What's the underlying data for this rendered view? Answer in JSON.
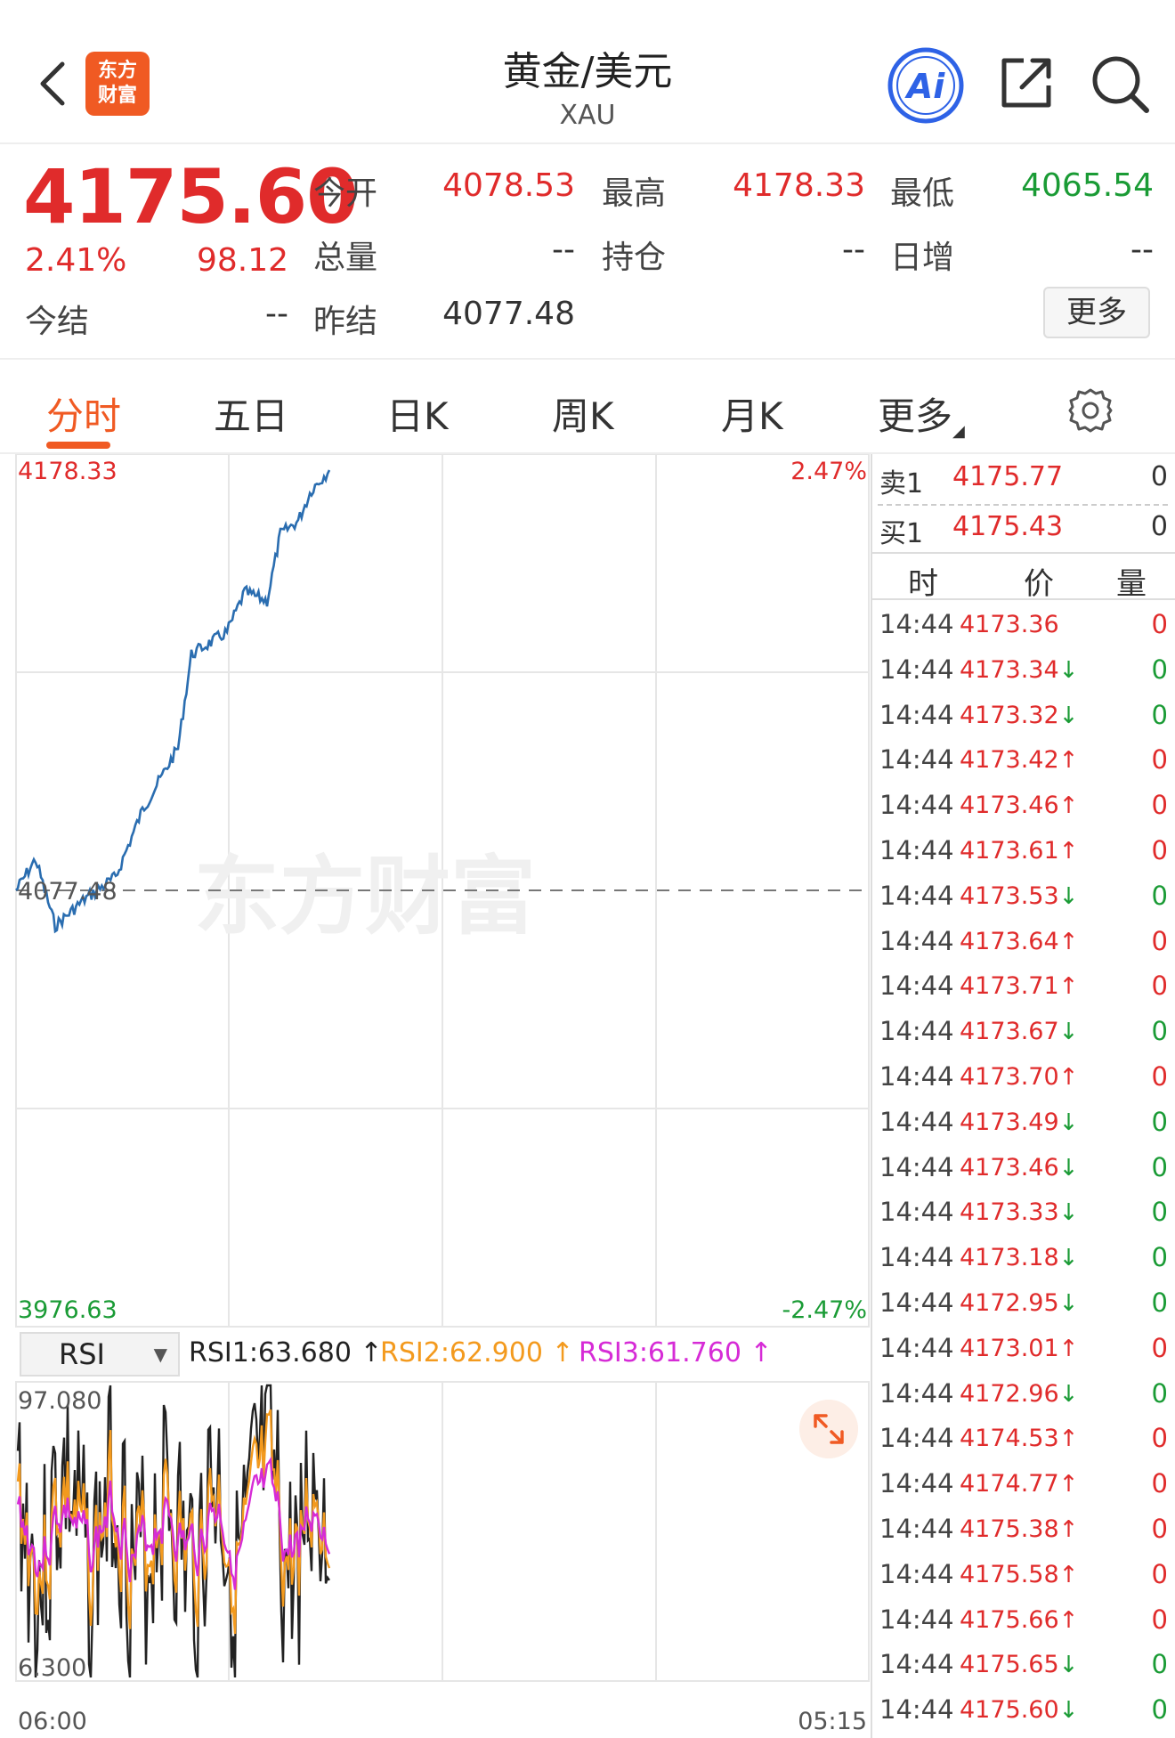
{
  "header": {
    "logo_line1": "东方",
    "logo_line2": "财富",
    "title": "黄金/美元",
    "subtitle": "XAU"
  },
  "quote": {
    "price": "4175.60",
    "pct": "2.41%",
    "change": "98.12",
    "open_label": "今开",
    "open_value": "4078.53",
    "high_label": "最高",
    "high_value": "4178.33",
    "low_label": "最低",
    "low_value": "4065.54",
    "volume_label": "总量",
    "volume_value": "--",
    "oi_label": "持仓",
    "oi_value": "--",
    "daily_label": "日增",
    "daily_value": "--",
    "settle_label": "今结",
    "settle_value": "--",
    "prev_settle_label": "昨结",
    "prev_settle_value": "4077.48",
    "more_label": "更多"
  },
  "tabs": [
    {
      "label": "分时",
      "active": true
    },
    {
      "label": "五日"
    },
    {
      "label": "日K"
    },
    {
      "label": "周K"
    },
    {
      "label": "月K"
    },
    {
      "label": "更多"
    }
  ],
  "chart": {
    "y_max_label": "4178.33",
    "y_min_label": "3976.63",
    "ref_label": "4077.48",
    "pct_max_label": "2.47%",
    "pct_min_label": "-2.47%",
    "watermark": "东方财富",
    "x_start_label": "06:00",
    "x_end_label": "05:15",
    "line_color": "#2a6db0"
  },
  "rsi": {
    "select_label": "RSI",
    "rsi1": "RSI1:63.680 ↑",
    "rsi2": "RSI2:62.900 ↑",
    "rsi3": "RSI3:61.760 ↑",
    "y_max_label": "97.080",
    "y_min_label": "6.300",
    "colors": {
      "rsi1": "#222222",
      "rsi2": "#f39a1e",
      "rsi3": "#d62bd6"
    }
  },
  "orderbook": {
    "sell": {
      "label": "卖1",
      "price": "4175.77",
      "qty": "0"
    },
    "buy": {
      "label": "买1",
      "price": "4175.43",
      "qty": "0"
    }
  },
  "tick_header": {
    "time": "时",
    "price": "价",
    "qty": "量"
  },
  "ticks": [
    {
      "time": "14:44",
      "price": "4173.36",
      "arrow": "",
      "qty": "0",
      "dir": "up"
    },
    {
      "time": "14:44",
      "price": "4173.34",
      "arrow": "↓",
      "qty": "0",
      "dir": "down"
    },
    {
      "time": "14:44",
      "price": "4173.32",
      "arrow": "↓",
      "qty": "0",
      "dir": "down"
    },
    {
      "time": "14:44",
      "price": "4173.42",
      "arrow": "↑",
      "qty": "0",
      "dir": "up"
    },
    {
      "time": "14:44",
      "price": "4173.46",
      "arrow": "↑",
      "qty": "0",
      "dir": "up"
    },
    {
      "time": "14:44",
      "price": "4173.61",
      "arrow": "↑",
      "qty": "0",
      "dir": "up"
    },
    {
      "time": "14:44",
      "price": "4173.53",
      "arrow": "↓",
      "qty": "0",
      "dir": "down"
    },
    {
      "time": "14:44",
      "price": "4173.64",
      "arrow": "↑",
      "qty": "0",
      "dir": "up"
    },
    {
      "time": "14:44",
      "price": "4173.71",
      "arrow": "↑",
      "qty": "0",
      "dir": "up"
    },
    {
      "time": "14:44",
      "price": "4173.67",
      "arrow": "↓",
      "qty": "0",
      "dir": "down"
    },
    {
      "time": "14:44",
      "price": "4173.70",
      "arrow": "↑",
      "qty": "0",
      "dir": "up"
    },
    {
      "time": "14:44",
      "price": "4173.49",
      "arrow": "↓",
      "qty": "0",
      "dir": "down"
    },
    {
      "time": "14:44",
      "price": "4173.46",
      "arrow": "↓",
      "qty": "0",
      "dir": "down"
    },
    {
      "time": "14:44",
      "price": "4173.33",
      "arrow": "↓",
      "qty": "0",
      "dir": "down"
    },
    {
      "time": "14:44",
      "price": "4173.18",
      "arrow": "↓",
      "qty": "0",
      "dir": "down"
    },
    {
      "time": "14:44",
      "price": "4172.95",
      "arrow": "↓",
      "qty": "0",
      "dir": "down"
    },
    {
      "time": "14:44",
      "price": "4173.01",
      "arrow": "↑",
      "qty": "0",
      "dir": "up"
    },
    {
      "time": "14:44",
      "price": "4172.96",
      "arrow": "↓",
      "qty": "0",
      "dir": "down"
    },
    {
      "time": "14:44",
      "price": "4174.53",
      "arrow": "↑",
      "qty": "0",
      "dir": "up"
    },
    {
      "time": "14:44",
      "price": "4174.77",
      "arrow": "↑",
      "qty": "0",
      "dir": "up"
    },
    {
      "time": "14:44",
      "price": "4175.38",
      "arrow": "↑",
      "qty": "0",
      "dir": "up"
    },
    {
      "time": "14:44",
      "price": "4175.58",
      "arrow": "↑",
      "qty": "0",
      "dir": "up"
    },
    {
      "time": "14:44",
      "price": "4175.66",
      "arrow": "↑",
      "qty": "0",
      "dir": "up"
    },
    {
      "time": "14:44",
      "price": "4175.65",
      "arrow": "↓",
      "qty": "0",
      "dir": "down"
    },
    {
      "time": "14:44",
      "price": "4175.60",
      "arrow": "↓",
      "qty": "0",
      "dir": "down"
    }
  ],
  "colors": {
    "up": "#e02b2b",
    "down": "#1a9b35",
    "accent": "#f05a23"
  },
  "icons": [
    "back-icon",
    "app-logo",
    "ai-icon",
    "share-icon",
    "search-icon",
    "gear-icon",
    "expand-icon"
  ]
}
